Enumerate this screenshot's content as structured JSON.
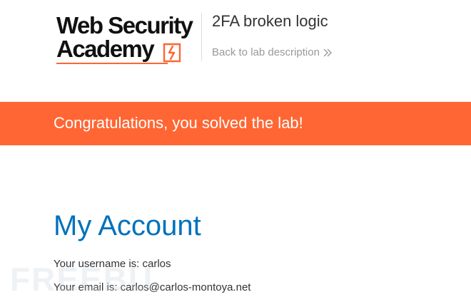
{
  "header": {
    "logo": {
      "line1": "Web Security",
      "line2": "Academy",
      "mark_icon": "lightning-bolt-icon"
    },
    "lab_title": "2FA broken logic",
    "back_link_label": "Back to lab description",
    "back_link_icon": "double-chevron-right-icon"
  },
  "banner": {
    "message": "Congratulations, you solved the lab!",
    "color": "#ff6633"
  },
  "main": {
    "title": "My Account",
    "username_line": "Your username is: carlos",
    "email_line": "Your email is: carlos@carlos-montoya.net"
  },
  "colors": {
    "accent": "#ff6633",
    "heading": "#0071bc",
    "text": "#333333",
    "muted": "#999999"
  },
  "watermark": {
    "text": "FREEBUF"
  }
}
